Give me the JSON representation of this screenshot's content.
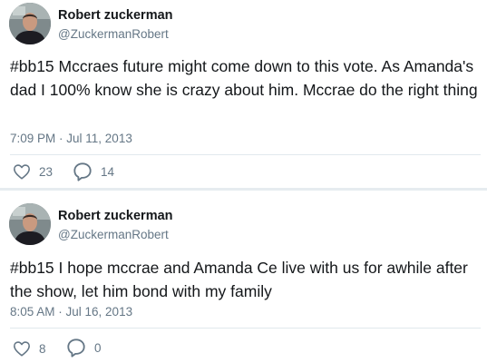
{
  "tweets": [
    {
      "author": {
        "display_name": "Robert zuckerman",
        "handle": "@ZuckermanRobert",
        "avatar_icon": "user-avatar"
      },
      "text": "#bb15 Mccraes future might come down to this vote. As Amanda's dad I 100% know she is crazy about him. Mccrae do the right thing",
      "timestamp": "7:09 PM · Jul 11, 2013",
      "likes": "23",
      "replies": "14",
      "like_icon": "heart-outline-icon",
      "reply_icon": "speech-bubble-icon"
    },
    {
      "author": {
        "display_name": "Robert zuckerman",
        "handle": "@ZuckermanRobert",
        "avatar_icon": "user-avatar"
      },
      "text": "#bb15 I hope mccrae and Amanda Ce live with us for awhile after the show, let him bond with my family",
      "timestamp": "8:05 AM · Jul 16, 2013",
      "likes": "8",
      "replies": "0",
      "like_icon": "heart-outline-icon",
      "reply_icon": "speech-bubble-icon"
    }
  ],
  "colors": {
    "text_primary": "#14171a",
    "text_secondary": "#657786",
    "divider": "#e1e8ed",
    "separator": "#e6ecf0",
    "background": "#ffffff"
  }
}
